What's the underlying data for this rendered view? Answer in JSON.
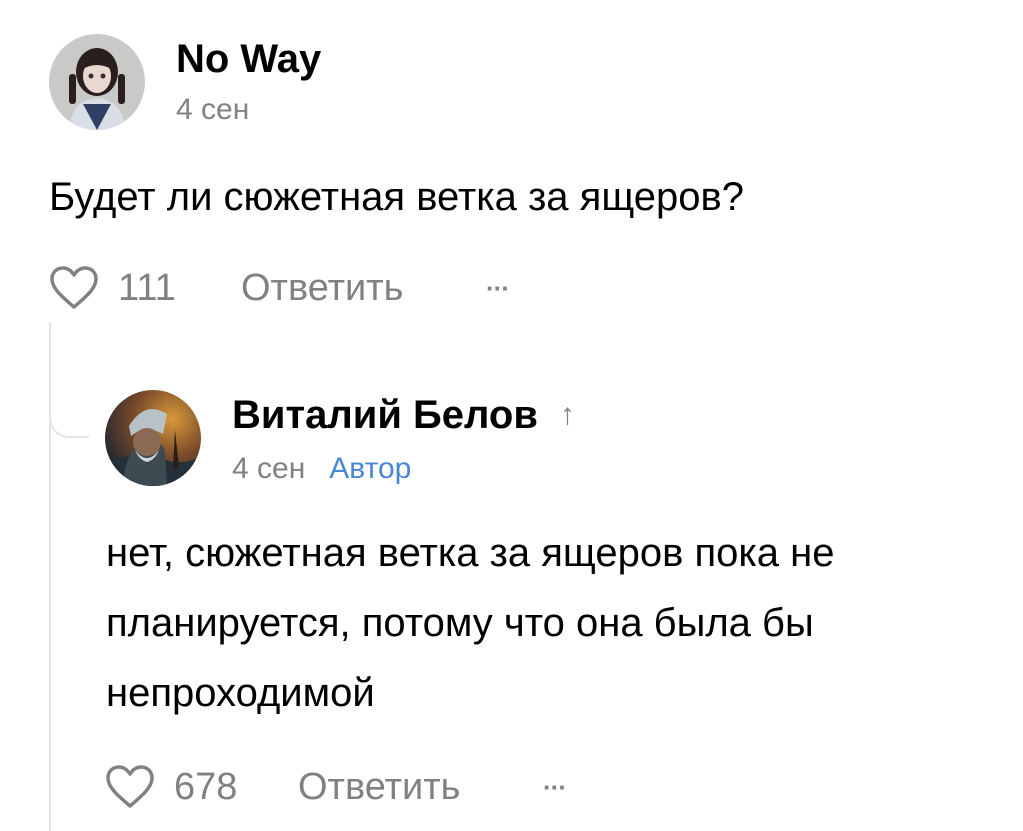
{
  "comment": {
    "author": "No Way",
    "date": "4 сен",
    "text": "Будет ли сюжетная ветка за ящеров?",
    "likes": "111",
    "reply_label": "Ответить",
    "more_label": "···",
    "icons": {
      "avatar": "avatar-girl-icon",
      "like": "heart-icon",
      "more": "more-dots-icon"
    }
  },
  "reply": {
    "author": "Виталий Белов",
    "reply_arrow": "↑",
    "date": "4 сен",
    "author_badge": "Автор",
    "text": "нет, сюжетная ветка за ящеров пока не планируется, потому что она была бы непроходимой",
    "likes": "678",
    "reply_label": "Ответить",
    "more_label": "···",
    "icons": {
      "avatar": "avatar-warrior-icon",
      "like": "heart-icon",
      "more": "more-dots-icon"
    }
  },
  "colors": {
    "text": "#000000",
    "secondary": "#818181",
    "author_badge": "#4a86d6",
    "thread_line": "#e3e4e8"
  }
}
